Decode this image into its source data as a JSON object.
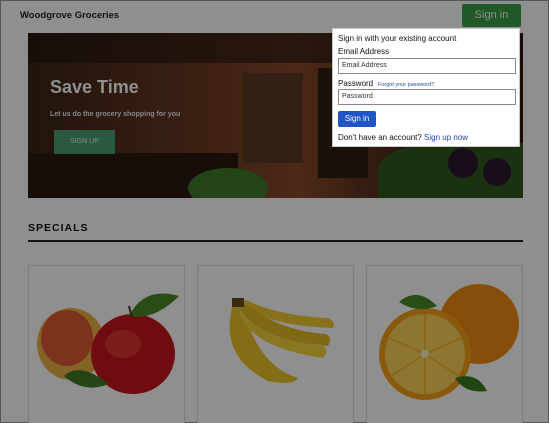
{
  "header": {
    "brand": "Woodgrove Groceries",
    "signin_button": "Sign in"
  },
  "hero": {
    "title": "Save Time",
    "subtitle": "Let us do the grocery shopping for you",
    "button": "SIGN UP"
  },
  "specials": {
    "title": "SPECIALS",
    "cards": [
      {
        "product": "apples",
        "icon": "apples-image"
      },
      {
        "product": "bananas",
        "icon": "bananas-image"
      },
      {
        "product": "oranges",
        "icon": "oranges-image"
      }
    ]
  },
  "signin_panel": {
    "heading": "Sign in with your existing account",
    "email_label": "Email Address",
    "email_placeholder": "Email Address",
    "password_label": "Password",
    "forgot_link": "Forgot your password?",
    "password_placeholder": "Password",
    "submit": "Sign in",
    "no_account": "Don't have an account?",
    "signup_link": "Sign up now"
  },
  "colors": {
    "header_button": "#3a9e48",
    "hero_button": "#4aa074",
    "submit_button": "#1f55c8",
    "link": "#1f4aa8"
  }
}
